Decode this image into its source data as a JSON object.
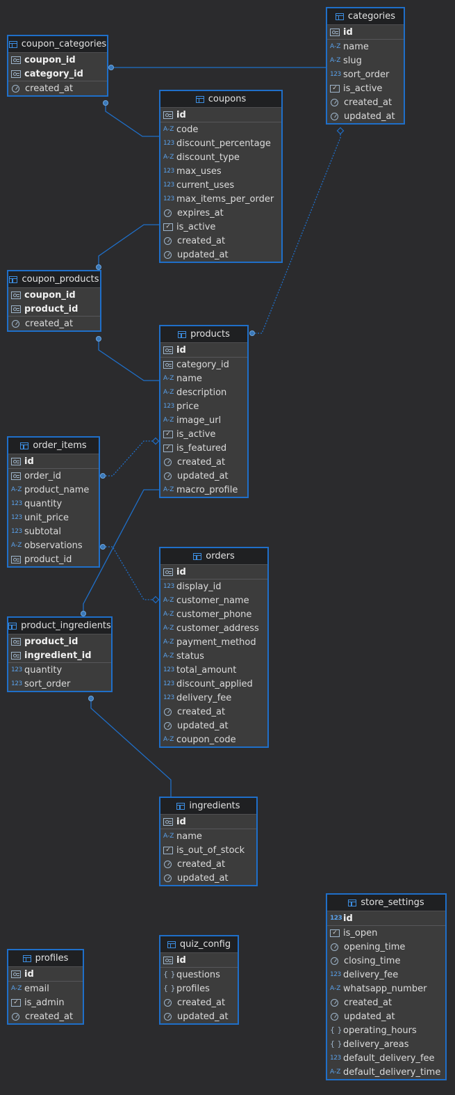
{
  "diagram": {
    "tables": [
      {
        "id": "coupon_categories",
        "title": "coupon_categories",
        "pk": [
          {
            "name": "coupon_id",
            "type": "key"
          },
          {
            "name": "category_id",
            "type": "key"
          }
        ],
        "cols": [
          {
            "name": "created_at",
            "type": "clock"
          }
        ]
      },
      {
        "id": "categories",
        "title": "categories",
        "pk": [
          {
            "name": "id",
            "type": "key"
          }
        ],
        "cols": [
          {
            "name": "name",
            "type": "text"
          },
          {
            "name": "slug",
            "type": "text"
          },
          {
            "name": "sort_order",
            "type": "number"
          },
          {
            "name": "is_active",
            "type": "check"
          },
          {
            "name": "created_at",
            "type": "clock"
          },
          {
            "name": "updated_at",
            "type": "clock"
          }
        ]
      },
      {
        "id": "coupons",
        "title": "coupons",
        "pk": [
          {
            "name": "id",
            "type": "key"
          }
        ],
        "cols": [
          {
            "name": "code",
            "type": "text"
          },
          {
            "name": "discount_percentage",
            "type": "number"
          },
          {
            "name": "discount_type",
            "type": "text"
          },
          {
            "name": "max_uses",
            "type": "number"
          },
          {
            "name": "current_uses",
            "type": "number"
          },
          {
            "name": "max_items_per_order",
            "type": "number"
          },
          {
            "name": "expires_at",
            "type": "clock"
          },
          {
            "name": "is_active",
            "type": "check"
          },
          {
            "name": "created_at",
            "type": "clock"
          },
          {
            "name": "updated_at",
            "type": "clock"
          }
        ]
      },
      {
        "id": "coupon_products",
        "title": "coupon_products",
        "pk": [
          {
            "name": "coupon_id",
            "type": "key"
          },
          {
            "name": "product_id",
            "type": "key"
          }
        ],
        "cols": [
          {
            "name": "created_at",
            "type": "clock"
          }
        ]
      },
      {
        "id": "products",
        "title": "products",
        "pk": [
          {
            "name": "id",
            "type": "key"
          }
        ],
        "cols": [
          {
            "name": "category_id",
            "type": "key"
          },
          {
            "name": "name",
            "type": "text"
          },
          {
            "name": "description",
            "type": "text"
          },
          {
            "name": "price",
            "type": "number"
          },
          {
            "name": "image_url",
            "type": "text"
          },
          {
            "name": "is_active",
            "type": "check"
          },
          {
            "name": "is_featured",
            "type": "check"
          },
          {
            "name": "created_at",
            "type": "clock"
          },
          {
            "name": "updated_at",
            "type": "clock"
          },
          {
            "name": "macro_profile",
            "type": "text"
          }
        ]
      },
      {
        "id": "order_items",
        "title": "order_items",
        "pk": [
          {
            "name": "id",
            "type": "key"
          }
        ],
        "cols": [
          {
            "name": "order_id",
            "type": "key"
          },
          {
            "name": "product_name",
            "type": "text"
          },
          {
            "name": "quantity",
            "type": "number"
          },
          {
            "name": "unit_price",
            "type": "number"
          },
          {
            "name": "subtotal",
            "type": "number"
          },
          {
            "name": "observations",
            "type": "text"
          },
          {
            "name": "product_id",
            "type": "key"
          }
        ]
      },
      {
        "id": "orders",
        "title": "orders",
        "pk": [
          {
            "name": "id",
            "type": "key"
          }
        ],
        "cols": [
          {
            "name": "display_id",
            "type": "number"
          },
          {
            "name": "customer_name",
            "type": "text"
          },
          {
            "name": "customer_phone",
            "type": "text"
          },
          {
            "name": "customer_address",
            "type": "text"
          },
          {
            "name": "payment_method",
            "type": "text"
          },
          {
            "name": "status",
            "type": "text"
          },
          {
            "name": "total_amount",
            "type": "number"
          },
          {
            "name": "discount_applied",
            "type": "number"
          },
          {
            "name": "delivery_fee",
            "type": "number"
          },
          {
            "name": "created_at",
            "type": "clock"
          },
          {
            "name": "updated_at",
            "type": "clock"
          },
          {
            "name": "coupon_code",
            "type": "text"
          }
        ]
      },
      {
        "id": "product_ingredients",
        "title": "product_ingredients",
        "pk": [
          {
            "name": "product_id",
            "type": "key"
          },
          {
            "name": "ingredient_id",
            "type": "key"
          }
        ],
        "cols": [
          {
            "name": "quantity",
            "type": "number"
          },
          {
            "name": "sort_order",
            "type": "number"
          }
        ]
      },
      {
        "id": "ingredients",
        "title": "ingredients",
        "pk": [
          {
            "name": "id",
            "type": "key"
          }
        ],
        "cols": [
          {
            "name": "name",
            "type": "text"
          },
          {
            "name": "is_out_of_stock",
            "type": "check"
          },
          {
            "name": "created_at",
            "type": "clock"
          },
          {
            "name": "updated_at",
            "type": "clock"
          }
        ]
      },
      {
        "id": "store_settings",
        "title": "store_settings",
        "pk": [
          {
            "name": "id",
            "type": "number"
          }
        ],
        "cols": [
          {
            "name": "is_open",
            "type": "check"
          },
          {
            "name": "opening_time",
            "type": "clock"
          },
          {
            "name": "closing_time",
            "type": "clock"
          },
          {
            "name": "delivery_fee",
            "type": "number"
          },
          {
            "name": "whatsapp_number",
            "type": "text"
          },
          {
            "name": "created_at",
            "type": "clock"
          },
          {
            "name": "updated_at",
            "type": "clock"
          },
          {
            "name": "operating_hours",
            "type": "json"
          },
          {
            "name": "delivery_areas",
            "type": "json"
          },
          {
            "name": "default_delivery_fee",
            "type": "number"
          },
          {
            "name": "default_delivery_time",
            "type": "text"
          }
        ]
      },
      {
        "id": "profiles",
        "title": "profiles",
        "pk": [
          {
            "name": "id",
            "type": "key"
          }
        ],
        "cols": [
          {
            "name": "email",
            "type": "text"
          },
          {
            "name": "is_admin",
            "type": "check"
          },
          {
            "name": "created_at",
            "type": "clock"
          }
        ]
      },
      {
        "id": "quiz_config",
        "title": "quiz_config",
        "pk": [
          {
            "name": "id",
            "type": "key"
          }
        ],
        "cols": [
          {
            "name": "questions",
            "type": "json"
          },
          {
            "name": "profiles",
            "type": "json"
          },
          {
            "name": "created_at",
            "type": "clock"
          },
          {
            "name": "updated_at",
            "type": "clock"
          }
        ]
      }
    ],
    "colors": {
      "background": "#2b2b2d",
      "table_border": "#1f6fc9",
      "line": "#1f6fc9",
      "header": "#1f2022",
      "body": "#3c3c3c"
    }
  }
}
